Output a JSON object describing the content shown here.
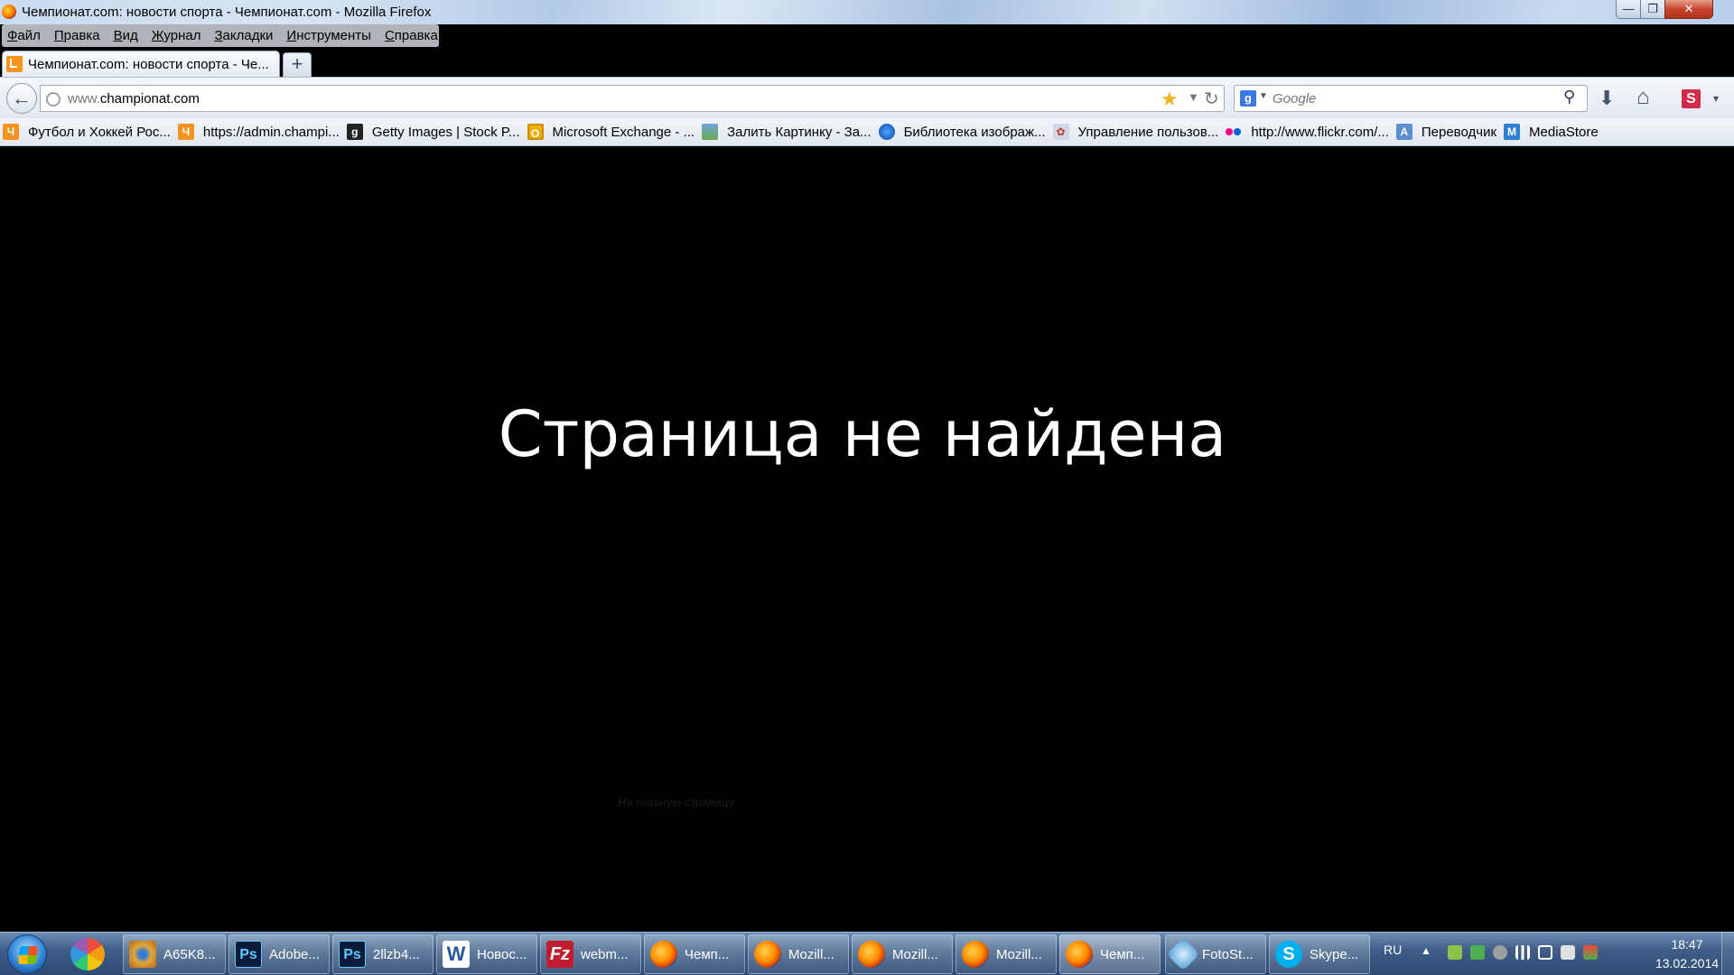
{
  "window": {
    "title": "Чемпионат.com: новости спорта - Чемпионат.com - Mozilla Firefox",
    "minimize_glyph": "—",
    "maximize_glyph": "❐",
    "close_glyph": "✕"
  },
  "menu": [
    "Файл",
    "Правка",
    "Вид",
    "Журнал",
    "Закладки",
    "Инструменты",
    "Справка"
  ],
  "tabs": [
    {
      "label": "Чемпионат.com: новости спорта - Че...",
      "icon": "championat-favicon"
    }
  ],
  "new_tab_glyph": "+",
  "navbar": {
    "back_glyph": "←",
    "url_prefix": "www.",
    "url_rest": "championat.com",
    "star_glyph": "★",
    "dropdown_glyph": "▼",
    "reload_glyph": "↻",
    "search_engine": "g",
    "search_placeholder": "Google",
    "search_glyph": "⚲",
    "download_glyph": "⬇",
    "home_glyph": "⌂",
    "s_label": "S",
    "menu_glyph": "▾"
  },
  "bookmarks": [
    {
      "label": "Футбол и Хоккей Рос...",
      "icon": "championat-favicon",
      "glyph": "Ч"
    },
    {
      "label": "https://admin.champi...",
      "icon": "championat-favicon",
      "glyph": "Ч"
    },
    {
      "label": "Getty Images | Stock P...",
      "icon": "getty-icon",
      "glyph": "g"
    },
    {
      "label": "Microsoft Exchange - ...",
      "icon": "owa-icon",
      "glyph": "O"
    },
    {
      "label": "Залить Картинку - За...",
      "icon": "image-upload-icon",
      "glyph": ""
    },
    {
      "label": "Библиотека изображ...",
      "icon": "library-icon",
      "glyph": ""
    },
    {
      "label": "Управление пользов...",
      "icon": "users-icon",
      "glyph": "✿"
    },
    {
      "label": "http://www.flickr.com/...",
      "icon": "flickr-icon",
      "glyph": ""
    },
    {
      "label": "Переводчик",
      "icon": "translate-icon",
      "glyph": "A"
    },
    {
      "label": "MediaStore",
      "icon": "mediastore-icon",
      "glyph": "M"
    }
  ],
  "content": {
    "error_title": "Страница не найдена",
    "home_link": "На главную страницу"
  },
  "taskbar": {
    "tasks": [
      {
        "label": "A65K8...",
        "icon": "eye-icon",
        "glyph": ""
      },
      {
        "label": "Adobe...",
        "icon": "photoshop-icon",
        "glyph": "Ps"
      },
      {
        "label": "2llzb4...",
        "icon": "photoshop-icon",
        "glyph": "Ps"
      },
      {
        "label": "Новос...",
        "icon": "word-icon",
        "glyph": "W"
      },
      {
        "label": "webm...",
        "icon": "filezilla-icon",
        "glyph": "Fz"
      },
      {
        "label": "Чемп...",
        "icon": "firefox-icon",
        "glyph": ""
      },
      {
        "label": "Mozill...",
        "icon": "firefox-icon",
        "glyph": ""
      },
      {
        "label": "Mozill...",
        "icon": "firefox-icon",
        "glyph": ""
      },
      {
        "label": "Mozill...",
        "icon": "firefox-icon",
        "glyph": ""
      },
      {
        "label": "Чемп...",
        "icon": "firefox-icon",
        "glyph": ""
      },
      {
        "label": "FotoSt...",
        "icon": "fotostars-icon",
        "glyph": ""
      },
      {
        "label": "Skype...",
        "icon": "skype-icon",
        "glyph": "S"
      }
    ],
    "language": "RU",
    "tray_up_glyph": "▲",
    "time": "18:47",
    "date": "13.02.2014"
  }
}
